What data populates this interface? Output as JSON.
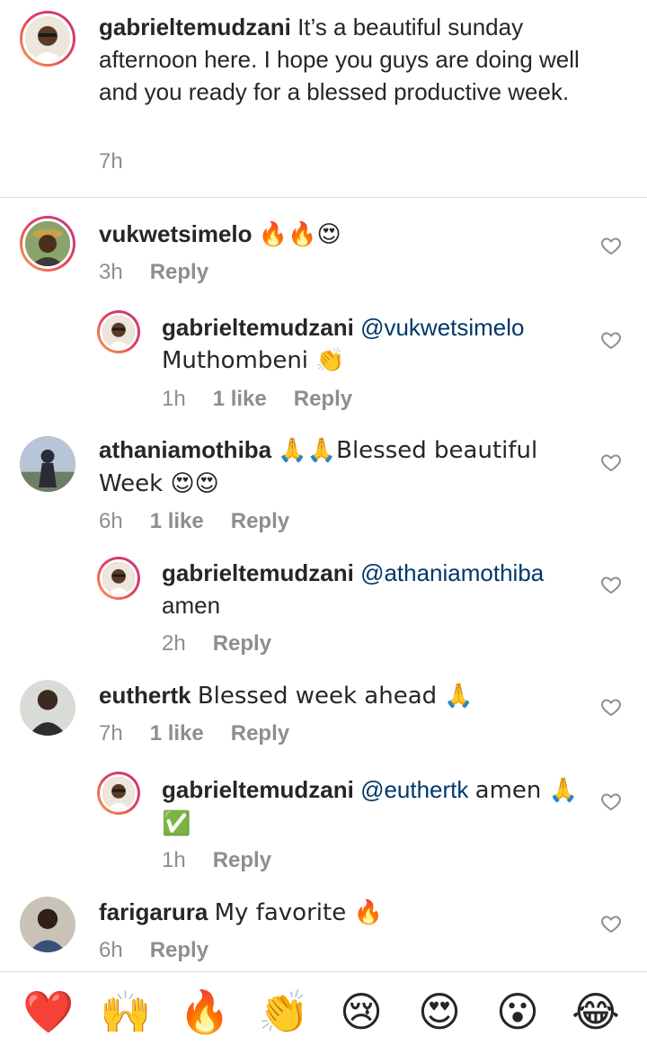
{
  "caption": {
    "username": "gabrieltemudzani",
    "text": "It’s a beautiful sunday afternoon here. I hope you guys are doing well and you ready for a blessed productive week.",
    "time": "7h"
  },
  "comments": [
    {
      "username": "vukwetsimelo",
      "text": "🔥🔥😍",
      "time": "3h",
      "likes": "",
      "reply": "Reply"
    },
    {
      "username": "gabrieltemudzani",
      "mention": "@vukwetsimelo",
      "text": "Muthombeni 👏",
      "time": "1h",
      "likes": "1 like",
      "reply": "Reply"
    },
    {
      "username": "athaniamothiba",
      "text": "🙏🙏Blessed beautiful Week 😍😍",
      "time": "6h",
      "likes": "1 like",
      "reply": "Reply"
    },
    {
      "username": "gabrieltemudzani",
      "mention": "@athaniamothiba",
      "text": "amen",
      "time": "2h",
      "likes": "",
      "reply": "Reply"
    },
    {
      "username": "euthertk",
      "text": "Blessed week ahead 🙏",
      "time": "7h",
      "likes": "1 like",
      "reply": "Reply"
    },
    {
      "username": "gabrieltemudzani",
      "mention": "@euthertk",
      "text": "amen 🙏✅",
      "time": "1h",
      "likes": "",
      "reply": "Reply"
    },
    {
      "username": "farigarura",
      "text": "My favorite 🔥",
      "time": "6h",
      "likes": "",
      "reply": "Reply"
    }
  ],
  "emoji_bar": [
    "❤️",
    "🙌",
    "🔥",
    "👏",
    "😢",
    "😍",
    "😮",
    "😂"
  ],
  "icons": {
    "like": "heart-outline-icon"
  }
}
